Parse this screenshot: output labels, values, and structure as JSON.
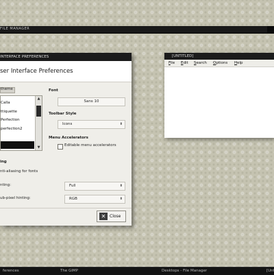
{
  "file_manager_bar": {
    "title": "FILE MANAGER"
  },
  "preferences_window": {
    "title": "INTERFACE PREFERENCES",
    "header": "ser Interface Preferences",
    "theme_tab": "theme",
    "themes": [
      "Calla",
      "ttiquette",
      "Perfection",
      "perfection2"
    ],
    "font_section": "Font",
    "font_value": "Sans 10",
    "toolbar_style_section": "Toolbar Style",
    "toolbar_style_value": "Icons",
    "menu_accelerators_section": "Menu Accelerators",
    "editable_accelerators_label": "Editable menu accelerators",
    "antialias_section": "ing",
    "antialias_label": "nti-aliasing for fonts",
    "hinting_label": "nting:",
    "hinting_value": "Full",
    "subpixel_label": "ub-pixel hinting:",
    "subpixel_value": "RGB",
    "close_button": "Close"
  },
  "untitled_window": {
    "title": "[UNTITLED]",
    "menus": [
      {
        "underline": "F",
        "rest": "ile"
      },
      {
        "underline": "E",
        "rest": "dit"
      },
      {
        "underline": "S",
        "rest": "earch"
      },
      {
        "underline": "O",
        "rest": "ptions"
      },
      {
        "underline": "H",
        "rest": "elp"
      }
    ]
  },
  "taskbar": {
    "items": [
      "ferences",
      "The GIMP",
      "Desktops - File Manager",
      "[Unt"
    ]
  }
}
